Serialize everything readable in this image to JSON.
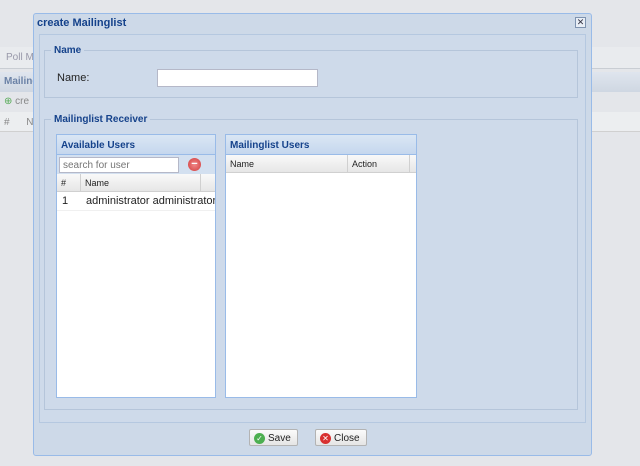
{
  "background": {
    "tab": "Poll Ma",
    "header": "Mailing",
    "create": "cre",
    "col_hash": "#",
    "col_name": "N"
  },
  "dialog": {
    "title": "create Mailinglist",
    "close_icon": "✕",
    "name_section": {
      "legend": "Name",
      "label": "Name:",
      "value": ""
    },
    "receiver_section": {
      "legend": "Mailinglist Receiver"
    },
    "available": {
      "title": "Available Users",
      "search_placeholder": "search for user",
      "columns": [
        "#",
        "Name"
      ],
      "rows": [
        {
          "num": "1",
          "name": "administrator administrator"
        }
      ]
    },
    "mailinglist": {
      "title": "Mailinglist Users",
      "columns": [
        "Name",
        "Action"
      ]
    },
    "buttons": {
      "save": "Save",
      "close": "Close"
    }
  }
}
